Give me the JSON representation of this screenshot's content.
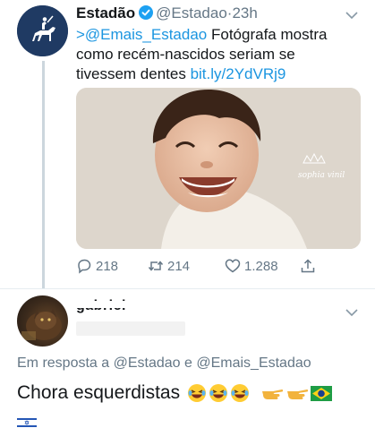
{
  "tweet": {
    "author_name": "Estadão",
    "author_handle": "@Estadao",
    "separator": "·",
    "time": "23h",
    "text_mention": ">@Emais_Estadao",
    "text_body": " Fotógrafa mostra como recém-nascidos seriam se tivessem dentes ",
    "text_link": "bit.ly/2YdVRj9",
    "photo_watermark": "sophia vinil",
    "replies": "218",
    "retweets": "214",
    "likes": "1.288"
  },
  "reply": {
    "author_name": "gabriel",
    "in_reply_to": "Em resposta a @Estadao e @Emais_Estadao",
    "text": "Chora esquerdistas"
  },
  "colors": {
    "link": "#1b95e0",
    "secondary_text": "#657786",
    "verified": "#1da1f2",
    "thread_line": "#ccd6dd"
  }
}
